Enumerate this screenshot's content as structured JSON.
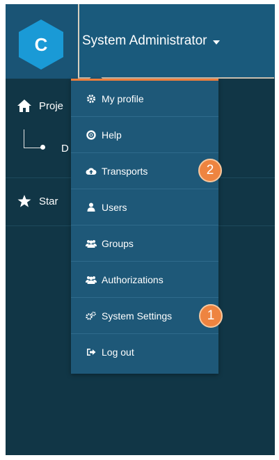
{
  "logo": {
    "letter": "C"
  },
  "header": {
    "user_label": "System Administrator"
  },
  "nav": {
    "items": [
      {
        "label": "Proje",
        "icon": "home-icon"
      },
      {
        "label": "D",
        "icon": "tree-node"
      },
      {
        "label": "Star",
        "icon": "star-icon"
      }
    ]
  },
  "menu": {
    "items": [
      {
        "label": "My profile",
        "icon": "gear-icon"
      },
      {
        "label": "Help",
        "icon": "lifebuoy-icon"
      },
      {
        "label": "Transports",
        "icon": "cloud-upload-icon"
      },
      {
        "label": "Users",
        "icon": "user-icon"
      },
      {
        "label": "Groups",
        "icon": "users-icon"
      },
      {
        "label": "Authorizations",
        "icon": "users-icon"
      },
      {
        "label": "System Settings",
        "icon": "gears-icon"
      },
      {
        "label": "Log out",
        "icon": "sign-out-icon"
      }
    ]
  },
  "callouts": {
    "first": "1",
    "second": "2"
  },
  "colors": {
    "sidebar": "#113646",
    "menu": "#1e5878",
    "accent": "#ee7e3c",
    "logo": "#1a9ad6"
  }
}
